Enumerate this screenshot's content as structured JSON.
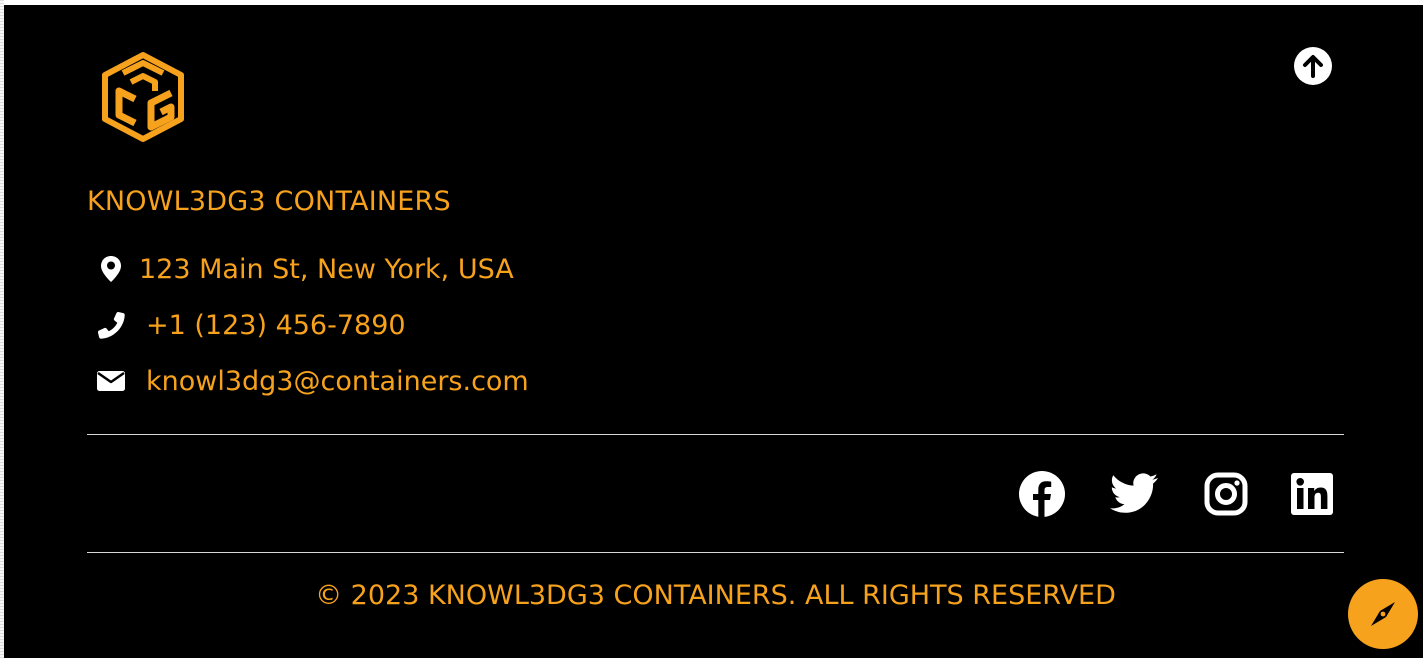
{
  "company": {
    "name": "KNOWL3DG3 CONTAINERS",
    "logo_letters": "CG",
    "logo_icon": "cube-logo"
  },
  "contact": {
    "address": "123 Main St, New York, USA",
    "phone": "+1 (123) 456-7890",
    "email": "knowl3dg3@containers.com",
    "address_icon": "map-pin-icon",
    "phone_icon": "phone-icon",
    "email_icon": "envelope-icon"
  },
  "social": [
    {
      "name": "facebook",
      "icon": "facebook-icon"
    },
    {
      "name": "twitter",
      "icon": "twitter-icon"
    },
    {
      "name": "instagram",
      "icon": "instagram-icon"
    },
    {
      "name": "linkedin",
      "icon": "linkedin-icon"
    }
  ],
  "back_to_top_icon": "arrow-up-icon",
  "explore_icon": "compass-icon",
  "copyright": "© 2023 KNOWL3DG3 CONTAINERS. ALL RIGHTS RESERVED",
  "colors": {
    "accent": "#f7a21d",
    "background": "#000000",
    "icon": "#ffffff"
  }
}
